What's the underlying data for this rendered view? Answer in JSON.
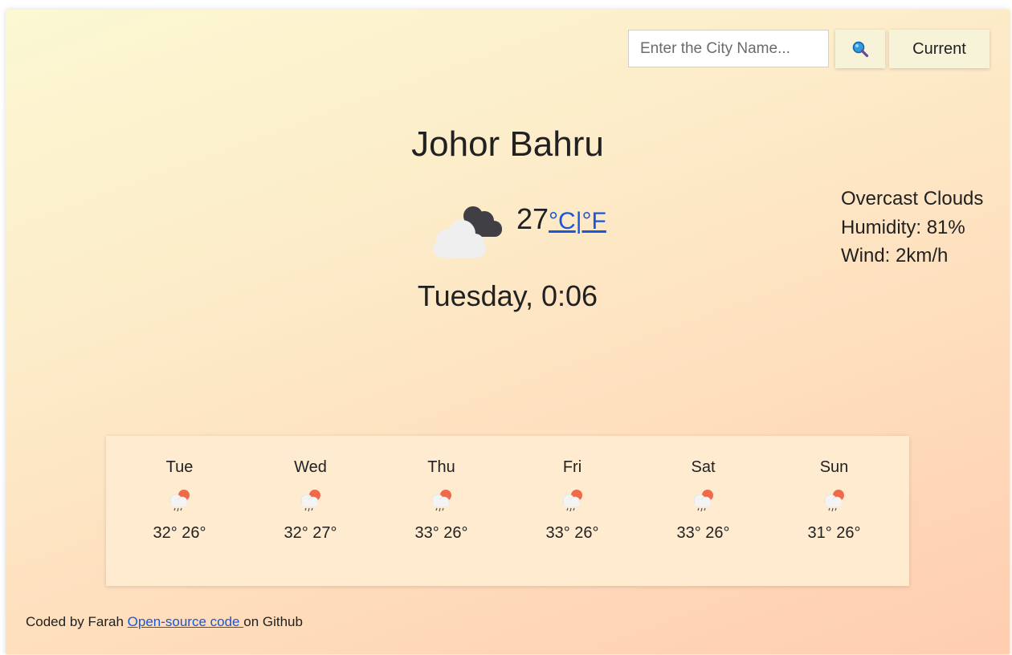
{
  "search": {
    "placeholder": "Enter the City Name...",
    "value": "",
    "search_icon": "magnifier-icon",
    "current_label": "Current"
  },
  "current": {
    "city": "Johor Bahru",
    "icon": "cloud-icon",
    "temperature": "27",
    "unit_celsius": "°C",
    "unit_separator": "|",
    "unit_fahrenheit": "°F",
    "description": "Overcast Clouds",
    "humidity": "Humidity: 81%",
    "wind": "Wind: 2km/h",
    "datetime": "Tuesday, 0:06"
  },
  "forecast": [
    {
      "day": "Tue",
      "temps": "32° 26°",
      "icon": "rain-icon"
    },
    {
      "day": "Wed",
      "temps": "32° 27°",
      "icon": "rain-icon"
    },
    {
      "day": "Thu",
      "temps": "33° 26°",
      "icon": "rain-icon"
    },
    {
      "day": "Fri",
      "temps": "33° 26°",
      "icon": "rain-icon"
    },
    {
      "day": "Sat",
      "temps": "33° 26°",
      "icon": "rain-icon"
    },
    {
      "day": "Sun",
      "temps": "31° 26°",
      "icon": "rain-icon"
    }
  ],
  "footer": {
    "prefix": "Coded by Farah ",
    "link_text": "Open-source code ",
    "suffix": "on Github"
  },
  "colors": {
    "link": "#1a56db",
    "gradient_start": "#fbf8d3",
    "gradient_end": "#ffcdb0",
    "forecast_bg": "#ffebd0"
  }
}
